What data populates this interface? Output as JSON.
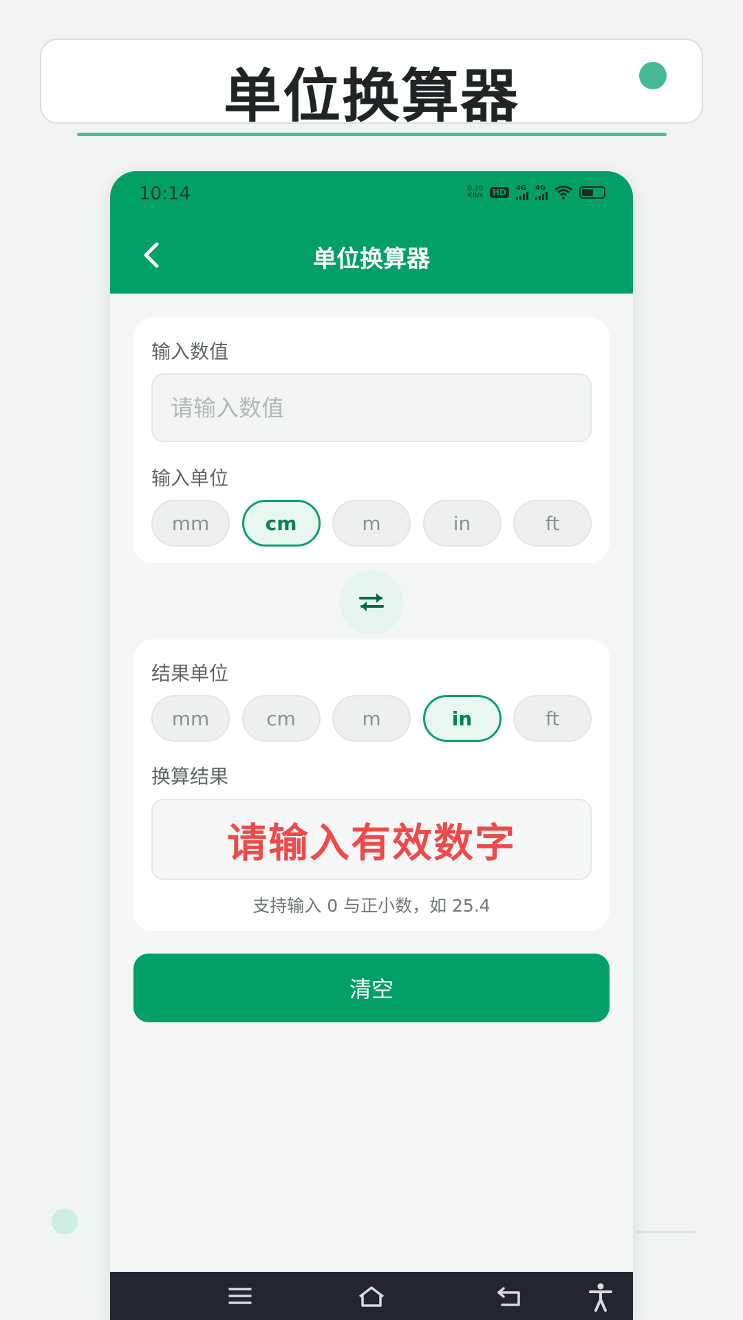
{
  "promo": {
    "title": "单位换算器"
  },
  "status": {
    "time": "10:14",
    "speed_top": "0.20",
    "speed_bottom": "KB/s",
    "hd": "HD",
    "net1": "4G",
    "net2": "4G"
  },
  "nav": {
    "title": "单位换算器"
  },
  "input_card": {
    "value_label": "输入数值",
    "placeholder": "请输入数值",
    "value": "",
    "unit_label": "输入单位",
    "units": [
      "mm",
      "cm",
      "m",
      "in",
      "ft"
    ],
    "selected": "cm"
  },
  "result_card": {
    "unit_label": "结果单位",
    "units": [
      "mm",
      "cm",
      "m",
      "in",
      "ft"
    ],
    "selected": "in",
    "result_label": "换算结果",
    "result_text": "请输入有效数字",
    "hint": "支持输入 0 与正小数，如 25.4"
  },
  "clear_label": "清空",
  "colors": {
    "primary": "#02a066",
    "error": "#ef4a4a",
    "chip_active_bg": "#e8f7f0"
  }
}
